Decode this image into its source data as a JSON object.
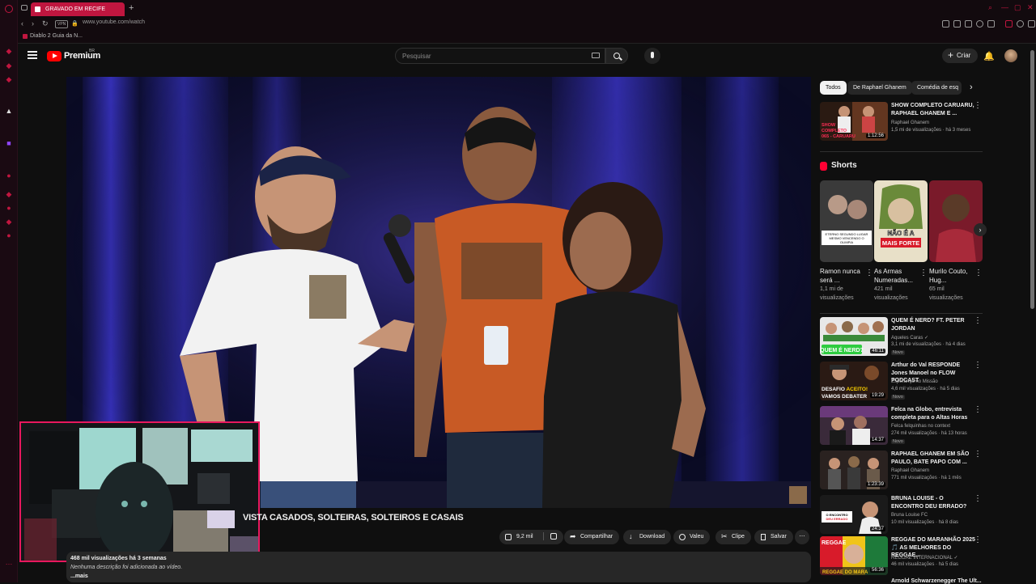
{
  "browser": {
    "tab_title": "GRAVADO EM RECIFE",
    "url": "www.youtube.com/watch",
    "vpn_label": "VPN",
    "bookmark": "Diablo 2 Guia da N...",
    "accent": "#c0163f"
  },
  "youtube": {
    "brand": "Premium",
    "country": "BR",
    "search_placeholder": "Pesquisar",
    "create_label": "Criar"
  },
  "video": {
    "title_visible": "VISTA CASADOS, SOLTEIRAS, SOLTEIROS E CASAIS",
    "likes": "9,2 mil",
    "actions": {
      "share": "Compartilhar",
      "download": "Download",
      "thanks": "Valeu",
      "clip": "Clipe",
      "save": "Salvar"
    },
    "stats": "468 mil visualizações  há 3 semanas",
    "description": "Nenhuma descrição foi adicionada ao vídeo.",
    "more": "...mais"
  },
  "sidebar": {
    "chips": [
      "Todos",
      "De Raphael Ghanem",
      "Comédia de esq"
    ],
    "top_rec": {
      "title": "SHOW COMPLETO CARUARU, RAPHAEL GHANEM E ...",
      "channel": "Raphael Ghanem",
      "meta": "1,5 mi de visualizações · há 3 meses",
      "duration": "1:12:56",
      "thumb_text": "SHOW COMPLETO 065 - CARUARU"
    },
    "shorts_heading": "Shorts",
    "shorts": [
      {
        "title": "Ramon nunca será ...",
        "views": "1,1 mi de visualizações",
        "thumb_text": "ETERNO SEGUNDO LUGAR MESMO VENCENDO O OLIMPIA"
      },
      {
        "title": "As Armas Numeradas...",
        "views": "421 mil visualizações",
        "thumb_text": "NÃO É A MAIS FORTE"
      },
      {
        "title": "Murilo Couto, Hug...",
        "views": "65 mil visualizações",
        "thumb_text": ""
      }
    ],
    "recs": [
      {
        "title": "QUEM É NERD? FT. PETER JORDAN",
        "channel": "Aqueles Caras ✓",
        "meta": "3,1 mi de visualizações · há 4 dias",
        "badge": "Novo",
        "duration": "46:11",
        "thumb_text": "QUEM É NERD?"
      },
      {
        "title": "Arthur do Val RESPONDE Jones Manoel no FLOW PODCAST",
        "channel": "Esperança no Missão",
        "meta": "4,6 mil visualizações · há 5 dias",
        "badge": "Novo",
        "duration": "19:29",
        "thumb_text": "DESAFIO ACEITO! VAMOS DEBATER"
      },
      {
        "title": "Felca na Globo, entrevista completa para o Altas Horas",
        "channel": "Felca felquinhas no context",
        "meta": "274 mil visualizações · há 13 horas",
        "badge": "Novo",
        "duration": "14:37",
        "thumb_text": ""
      },
      {
        "title": "RAPHAEL GHANEM EM SÃO PAULO, BATE PAPO COM ...",
        "channel": "Raphael Ghanem",
        "meta": "771 mil visualizações · há 1 mês",
        "badge": "",
        "duration": "1:23:39",
        "thumb_text": ""
      },
      {
        "title": "BRUNA LOUISE - O ENCONTRO DEU ERRADO?",
        "channel": "Bruna Louise FC",
        "meta": "10 mil visualizações · há 8 dias",
        "badge": "",
        "duration": "24:37",
        "thumb_text": "O ENCONTRO DEU ERRADO"
      },
      {
        "title": "REGGAE DO MARANHÃO 2025 🎵 AS MELHORES DO REGGAE...",
        "channel": "REGGAE INTERNACIONAL ✓",
        "meta": "46 mil visualizações · há 5 dias",
        "badge": "",
        "duration": "56:36",
        "thumb_text": "REGGAE DO MARANHÃO"
      }
    ],
    "last_rec_title": "Arnold Schwarzenegger The Ult..."
  }
}
